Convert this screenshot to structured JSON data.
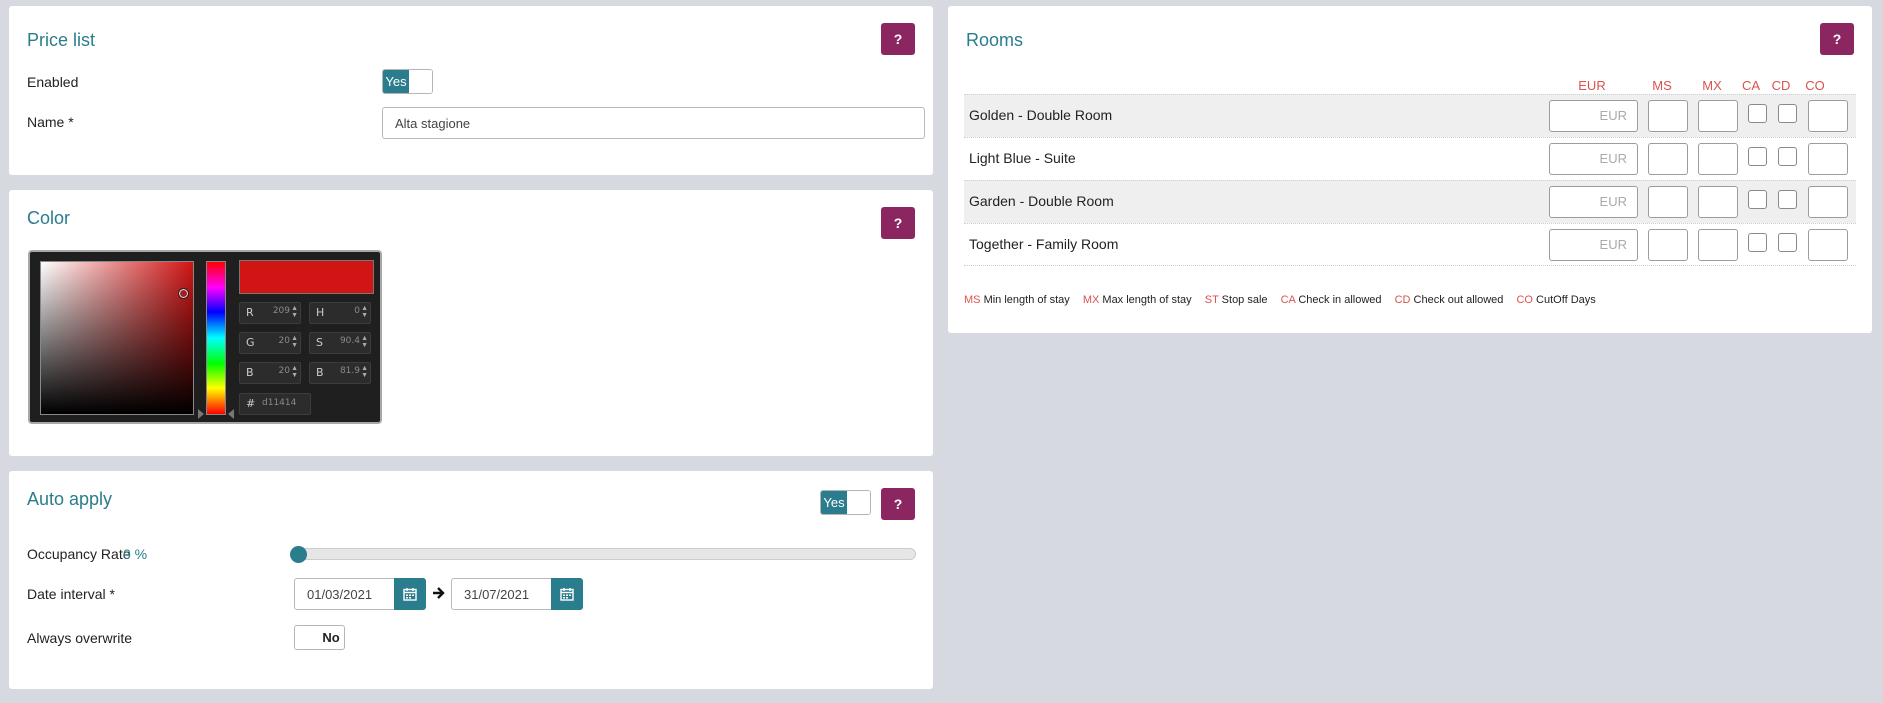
{
  "price_list": {
    "title": "Price list",
    "help_label": "?",
    "enabled_label": "Enabled",
    "enabled_value": "Yes",
    "name_label": "Name *",
    "name_value": "Alta stagione"
  },
  "color": {
    "title": "Color",
    "help_label": "?",
    "swatch_color": "#d11414",
    "fields": {
      "r_label": "R",
      "r_value": "209",
      "g_label": "G",
      "g_value": "20",
      "b_label": "B",
      "b_value": "20",
      "h_label": "H",
      "h_value": "0",
      "s_label": "S",
      "s_value": "90.4",
      "bv_label": "B",
      "bv_value": "81.9",
      "hex_label": "#",
      "hex_value": "d11414"
    }
  },
  "auto_apply": {
    "title": "Auto apply",
    "help_label": "?",
    "toggle_value": "Yes",
    "occupancy_label": "Occupancy Rate",
    "occupancy_value": "0 %",
    "occupancy_fraction": 0,
    "date_interval_label": "Date interval *",
    "date_from": "01/03/2021",
    "date_to": "31/07/2021",
    "always_overwrite_label": "Always overwrite",
    "always_overwrite_value": "No"
  },
  "rooms": {
    "title": "Rooms",
    "help_label": "?",
    "columns": [
      "EUR",
      "MS",
      "MX",
      "CA",
      "CD",
      "CO"
    ],
    "eur_placeholder": "EUR",
    "rows": [
      {
        "name": "Golden - Double Room"
      },
      {
        "name": "Light Blue - Suite"
      },
      {
        "name": "Garden - Double Room"
      },
      {
        "name": "Together - Family Room"
      }
    ],
    "legend": [
      {
        "code": "MS",
        "text": "Min length of stay"
      },
      {
        "code": "MX",
        "text": "Max length of stay"
      },
      {
        "code": "ST",
        "text": "Stop sale"
      },
      {
        "code": "CA",
        "text": "Check in allowed"
      },
      {
        "code": "CD",
        "text": "Check out allowed"
      },
      {
        "code": "CO",
        "text": "CutOff Days"
      }
    ]
  },
  "colors": {
    "accent": "#2a7d8c",
    "help_button": "#8b2660",
    "column_header": "#d9534f"
  }
}
